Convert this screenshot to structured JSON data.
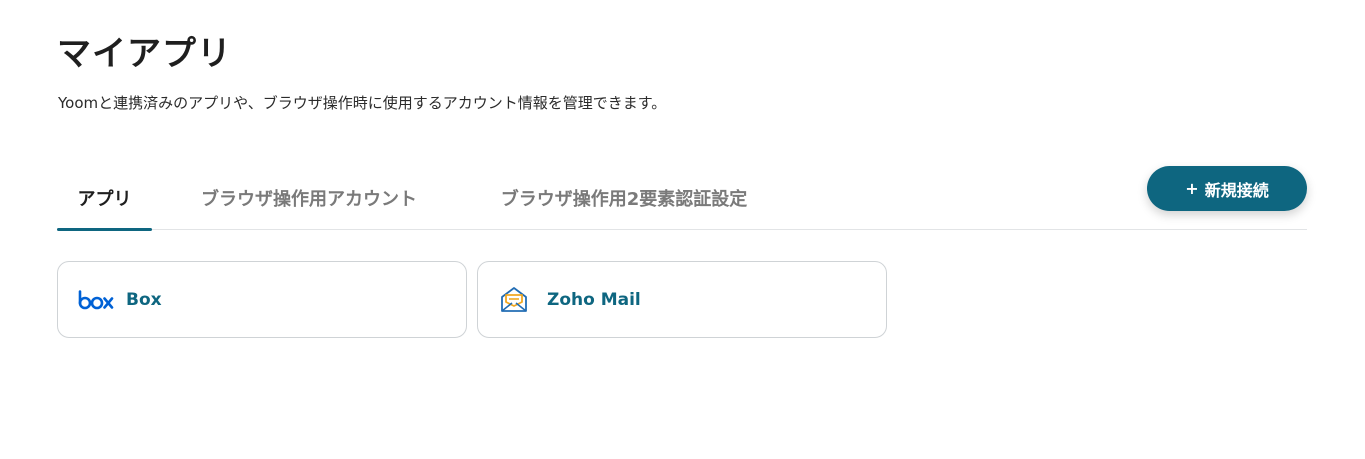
{
  "page": {
    "title": "マイアプリ",
    "subtitle": "Yoomと連携済みのアプリや、ブラウザ操作時に使用するアカウント情報を管理できます。"
  },
  "tabs": [
    {
      "label": "アプリ",
      "active": true
    },
    {
      "label": "ブラウザ操作用アカウント",
      "active": false
    },
    {
      "label": "ブラウザ操作用2要素認証設定",
      "active": false
    }
  ],
  "new_connection_button": {
    "icon": "+",
    "label": "新規接続"
  },
  "apps": [
    {
      "name": "Box",
      "icon": "box-logo-icon"
    },
    {
      "name": "Zoho Mail",
      "icon": "zoho-mail-icon"
    }
  ],
  "colors": {
    "accent": "#0e6680",
    "border": "#cfd3d6",
    "divider": "#e2e4e6",
    "inactive_tab": "#7a7a7a"
  }
}
